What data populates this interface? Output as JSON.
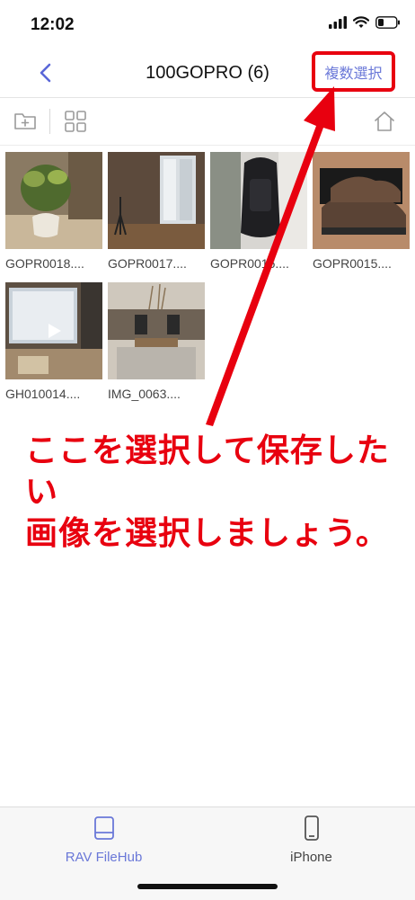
{
  "status": {
    "time": "12:02"
  },
  "nav": {
    "title": "100GOPRO (6)",
    "multi_select_label": "複数選択"
  },
  "files": [
    {
      "name": "GOPR0018...."
    },
    {
      "name": "GOPR0017...."
    },
    {
      "name": "GOPR0016...."
    },
    {
      "name": "GOPR0015...."
    },
    {
      "name": "GH010014...."
    },
    {
      "name": "IMG_0063...."
    }
  ],
  "annotation": {
    "line1": "ここを選択して保存したい",
    "line2": "画像を選択しましょう。"
  },
  "tabs": [
    {
      "label": "RAV FileHub"
    },
    {
      "label": "iPhone"
    }
  ],
  "colors": {
    "accent": "#6a78d8",
    "annotation_red": "#e8000f"
  }
}
